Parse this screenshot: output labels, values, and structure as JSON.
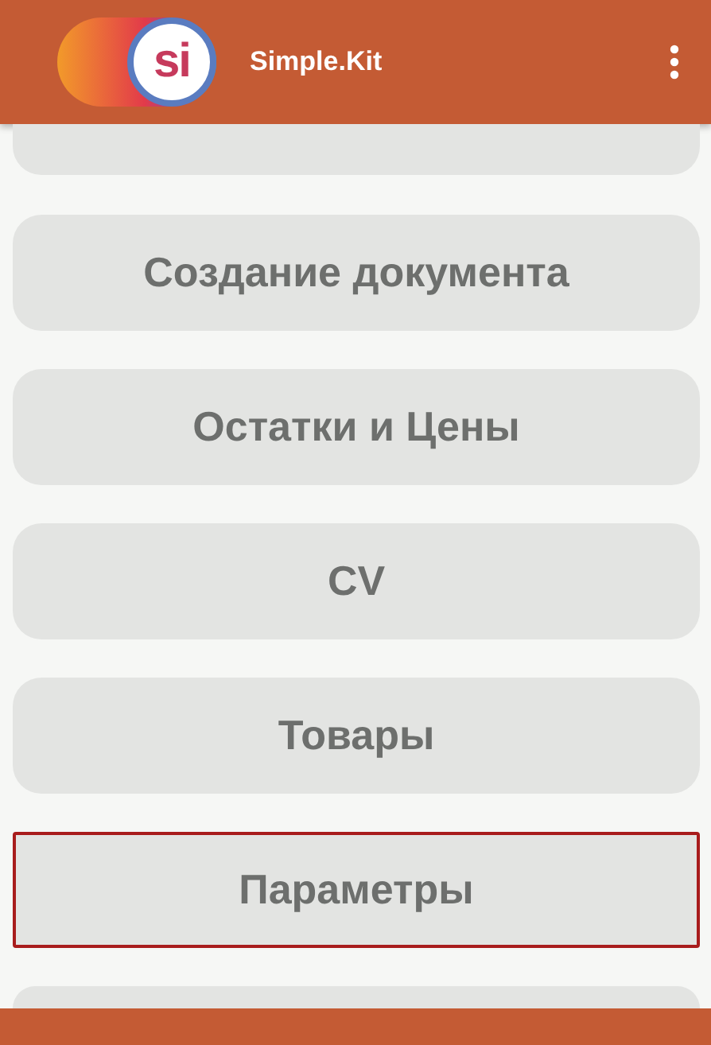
{
  "app_bar": {
    "logo_text": "si",
    "title": "Simple.Kit"
  },
  "menu_buttons": [
    {
      "kind": "cut_top",
      "selected": false
    },
    {
      "kind": "full",
      "label": "Создание документа",
      "selected": false
    },
    {
      "kind": "full",
      "label": "Остатки и Цены",
      "selected": false
    },
    {
      "kind": "full",
      "label": "CV",
      "selected": false
    },
    {
      "kind": "full",
      "label": "Товары",
      "selected": false
    },
    {
      "kind": "full",
      "label": "Параметры",
      "selected": true
    },
    {
      "kind": "cut_bottom",
      "selected": false
    }
  ]
}
